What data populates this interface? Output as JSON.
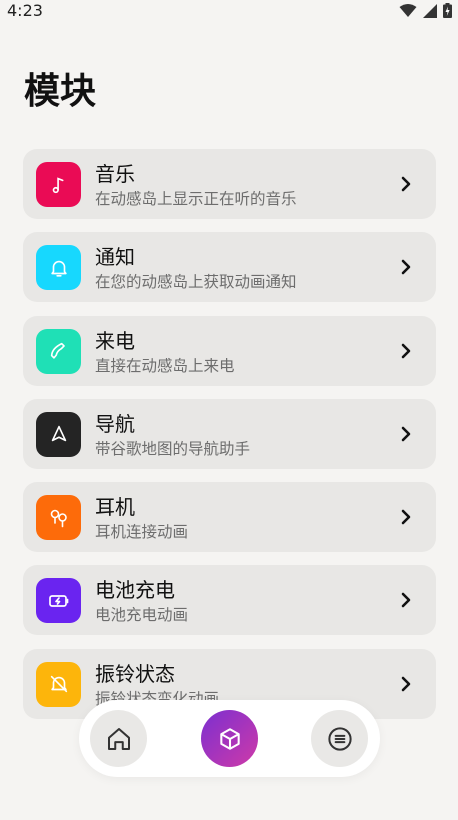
{
  "status_bar": {
    "time": "4:23"
  },
  "page": {
    "title": "模块"
  },
  "modules": [
    {
      "title": "音乐",
      "description": "在动感岛上显示正在听的音乐",
      "icon": "music-note-icon",
      "color": "#ea0b55"
    },
    {
      "title": "通知",
      "description": "在您的动感岛上获取动画通知",
      "icon": "bell-icon",
      "color": "#17d8fe"
    },
    {
      "title": "来电",
      "description": "直接在动感岛上来电",
      "icon": "phone-icon",
      "color": "#1fe0b6"
    },
    {
      "title": "导航",
      "description": "带谷歌地图的导航助手",
      "icon": "navigation-arrow-icon",
      "color": "#242424"
    },
    {
      "title": "耳机",
      "description": "耳机连接动画",
      "icon": "earbuds-icon",
      "color": "#fd6b0a"
    },
    {
      "title": "电池充电",
      "description": "电池充电动画",
      "icon": "battery-charging-icon",
      "color": "#6a24f0"
    },
    {
      "title": "振铃状态",
      "description": "振铃状态变化动画",
      "icon": "bell-muted-icon",
      "color": "#fdb50b"
    }
  ],
  "bottom_nav": {
    "items": [
      {
        "icon": "home-icon",
        "active": false
      },
      {
        "icon": "modules-cube-icon",
        "active": true
      },
      {
        "icon": "menu-list-icon",
        "active": false
      }
    ],
    "active_gradient": [
      "#7b2fd0",
      "#cf3aa8"
    ]
  }
}
